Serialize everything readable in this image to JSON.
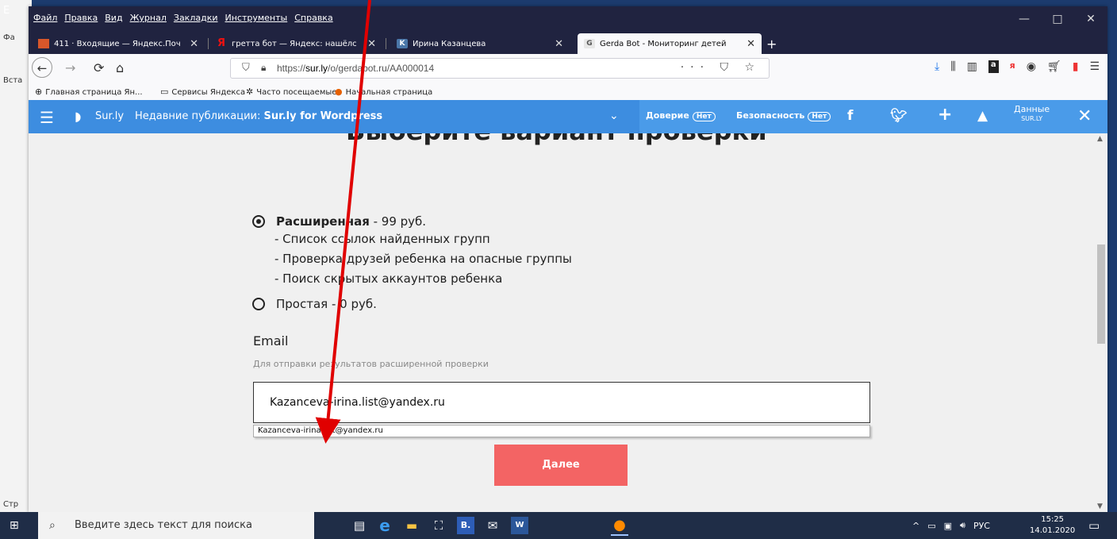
{
  "background_app": {
    "lines": [
      "Е",
      "Фа",
      "Вста",
      "Стр"
    ]
  },
  "menu": {
    "items": [
      "Файл",
      "Правка",
      "Вид",
      "Журнал",
      "Закладки",
      "Инструменты",
      "Справка"
    ],
    "minimize": "—",
    "maximize": "□",
    "close": "✕"
  },
  "tabs": [
    {
      "title": "411 · Входящие — Яндекс.Поч",
      "icon": "mail-icon"
    },
    {
      "title": "гретта бот — Яндекс: нашёлс",
      "icon": "yandex-icon"
    },
    {
      "title": "Ирина Казанцева",
      "icon": "vk-icon"
    },
    {
      "title": "Gerda Bot - Мониторинг детей",
      "icon": "gerda-icon"
    }
  ],
  "tab_close": "✕",
  "new_tab": "+",
  "nav": {
    "url_prefix": "https://",
    "url_host": "sur.ly",
    "url_path": "/o/gerdabot.ru/AA000014",
    "url_actions": "··· ⛉ ☆",
    "back": "←",
    "forward": "→",
    "reload": "⟳",
    "home": "⌂"
  },
  "bookmarks": [
    {
      "label": "Главная страница Ян...",
      "icon": "globe-icon"
    },
    {
      "label": "Сервисы Яндекса",
      "icon": "folder-icon"
    },
    {
      "label": "Часто посещаемые",
      "icon": "gear-icon"
    },
    {
      "label": "Начальная страница",
      "icon": "firefox-icon"
    }
  ],
  "surly": {
    "brand": "Sur.ly",
    "recent_prefix": "Недавние публикации:",
    "recent_title": "Sur.ly for Wordpress",
    "trust_label": "Доверие",
    "trust_value": "Нет",
    "security_label": "Безопасность",
    "security_value": "Нет",
    "data_label": "Данные",
    "data_sub": "SUR.LY"
  },
  "content": {
    "heading": "Выберите вариант проверки",
    "option_extended": {
      "name": "Расширенная",
      "price": " - 99 руб.",
      "selected": true
    },
    "features": [
      "- Список ссылок найденных групп",
      "- Проверка друзей ребенка на опасные группы",
      "- Поиск скрытых аккаунтов ребенка"
    ],
    "option_simple": {
      "name": "Простая",
      "price": " - 0 руб.",
      "selected": false
    },
    "email_label": "Email",
    "email_hint": "Для отправки результатов расширенной проверки",
    "email_value": "Kazanceva-irina.list@yandex.ru",
    "autocomplete_suggestion": "Kazanceva-irina.list@yandex.ru",
    "next_button": "Далее"
  },
  "taskbar": {
    "search_placeholder": "Введите здесь текст для поиска",
    "language": "РУС",
    "time": "15:25",
    "date": "14.01.2020"
  },
  "colors": {
    "surly_blue": "#3d8de0",
    "next_button": "#f36464",
    "annotation_arrow": "#e00000"
  }
}
